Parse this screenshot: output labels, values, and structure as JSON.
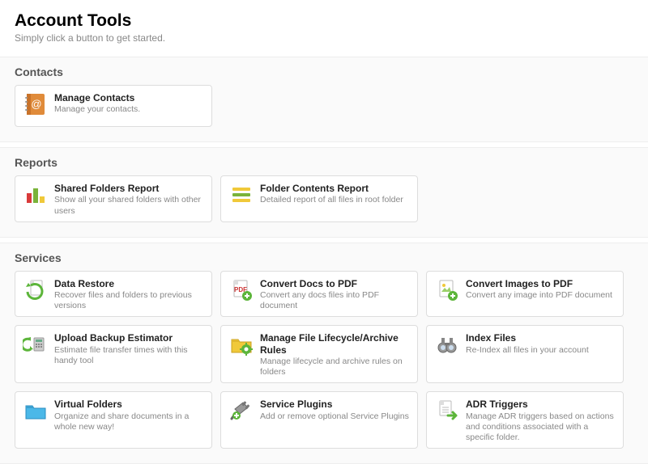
{
  "header": {
    "title": "Account Tools",
    "subtitle": "Simply click a button to get started."
  },
  "sections": {
    "contacts": {
      "title": "Contacts"
    },
    "reports": {
      "title": "Reports"
    },
    "services": {
      "title": "Services"
    }
  },
  "cards": {
    "manage_contacts": {
      "title": "Manage Contacts",
      "desc": "Manage your contacts."
    },
    "shared_folders_report": {
      "title": "Shared Folders Report",
      "desc": "Show all your shared folders with other users"
    },
    "folder_contents_report": {
      "title": "Folder Contents Report",
      "desc": "Detailed report of all files in root folder"
    },
    "data_restore": {
      "title": "Data Restore",
      "desc": "Recover files and folders to previous versions"
    },
    "convert_docs_pdf": {
      "title": "Convert Docs to PDF",
      "desc": "Convert any docs files into PDF document"
    },
    "convert_images_pdf": {
      "title": "Convert Images to PDF",
      "desc": "Convert any image into PDF document"
    },
    "upload_estimator": {
      "title": "Upload Backup Estimator",
      "desc": "Estimate file transfer times with this handy tool"
    },
    "lifecycle_rules": {
      "title": "Manage File Lifecycle/Archive Rules",
      "desc": "Manage lifecycle and archive rules on folders"
    },
    "index_files": {
      "title": "Index Files",
      "desc": "Re-Index all files in your account"
    },
    "virtual_folders": {
      "title": "Virtual Folders",
      "desc": "Organize and share documents in a whole new way!"
    },
    "service_plugins": {
      "title": "Service Plugins",
      "desc": "Add or remove optional Service Plugins"
    },
    "adr_triggers": {
      "title": "ADR Triggers",
      "desc": "Manage ADR triggers based on actions and conditions associated with a specific folder."
    }
  }
}
